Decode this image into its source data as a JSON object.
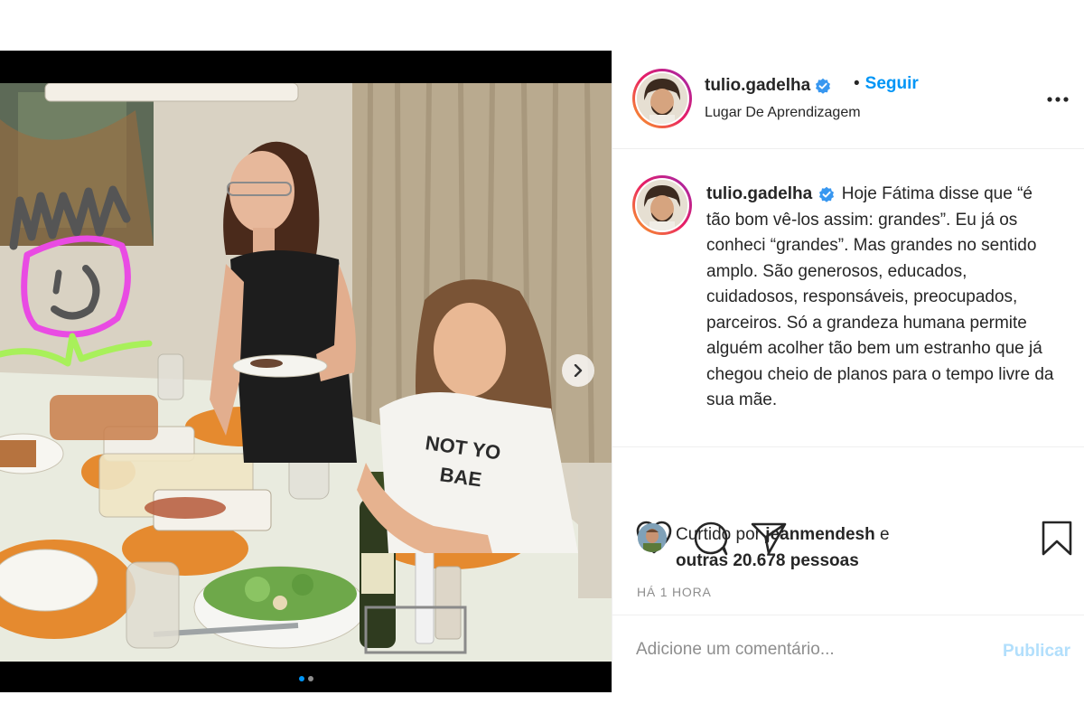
{
  "post": {
    "username": "tulio.gadelha",
    "separator": "•",
    "follow_label": "Seguir",
    "location": "Lugar De Aprendizagem",
    "caption_username": "tulio.gadelha",
    "caption_text": "Hoje Fátima disse que “é tão bom vê-los assim: grandes”. Eu já os conheci “grandes”. Mas grandes no sentido amplo. São generosos, educados, cuidadosos, responsáveis, preocupados, parceiros. Só a grandeza humana permite alguém acolher tão bem um estranho que já chegou cheio de planos para o tempo livre da sua mãe.",
    "likes_prefix": "Curtido por",
    "likes_user": "jeanmendesh",
    "likes_conj": "e",
    "likes_others": "outras 20.678 pessoas",
    "timestamp": "HÁ 1 HORA",
    "comment_placeholder": "Adicione um comentário...",
    "publish_label": "Publicar"
  },
  "media": {
    "shirt_text_line1": "NOT YO",
    "shirt_text_line2": "BAE",
    "carousel_count": 2,
    "carousel_index": 1
  },
  "icons": {
    "more": "more-options-icon",
    "verified": "verified-badge-icon",
    "like": "heart-icon",
    "comment": "comment-icon",
    "share": "send-icon",
    "save": "bookmark-icon",
    "next": "chevron-right-icon"
  },
  "colors": {
    "link_blue": "#0095f6",
    "publish_disabled": "#b2dffc",
    "muted": "#8e8e8e",
    "text": "#262626"
  }
}
